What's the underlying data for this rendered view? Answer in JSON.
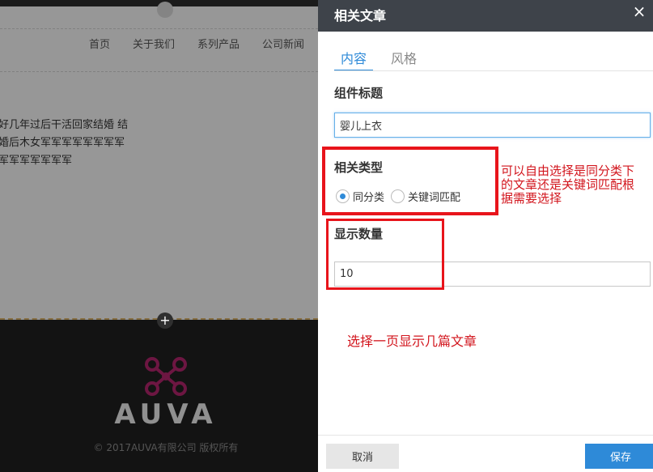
{
  "background_site": {
    "nav": [
      "首页",
      "关于我们",
      "系列产品",
      "公司新闻"
    ],
    "article_lines": [
      "好几年过后干活回家结婚   结",
      "婚后木女军军军军军军军军",
      "军军军军军军军"
    ],
    "brand": "AUVA",
    "copyright": "© 2017AUVA有限公司 版权所有",
    "plus_icon": "+"
  },
  "panel": {
    "title": "相关文章",
    "close_icon": "×",
    "tabs": [
      {
        "label": "内容",
        "active": true
      },
      {
        "label": "风格",
        "active": false
      }
    ],
    "component_title_label": "组件标题",
    "component_title_value": "婴儿上衣",
    "related_type_label": "相关类型",
    "related_type_options": [
      {
        "label": "同分类",
        "checked": true
      },
      {
        "label": "关键词匹配",
        "checked": false
      }
    ],
    "display_count_label": "显示数量",
    "display_count_value": "10",
    "cancel_label": "取消",
    "save_label": "保存"
  },
  "annotations": {
    "related_type_note": [
      "可以自由选择是同分类下",
      "的文章还是关键词匹配根",
      "据需要选择"
    ],
    "display_count_note": "选择一页显示几篇文章"
  },
  "colors": {
    "panel_header": "#3e434a",
    "accent": "#2e8ad8",
    "annotation_red": "#e8141b",
    "footer_bg": "#1f1f1f"
  }
}
